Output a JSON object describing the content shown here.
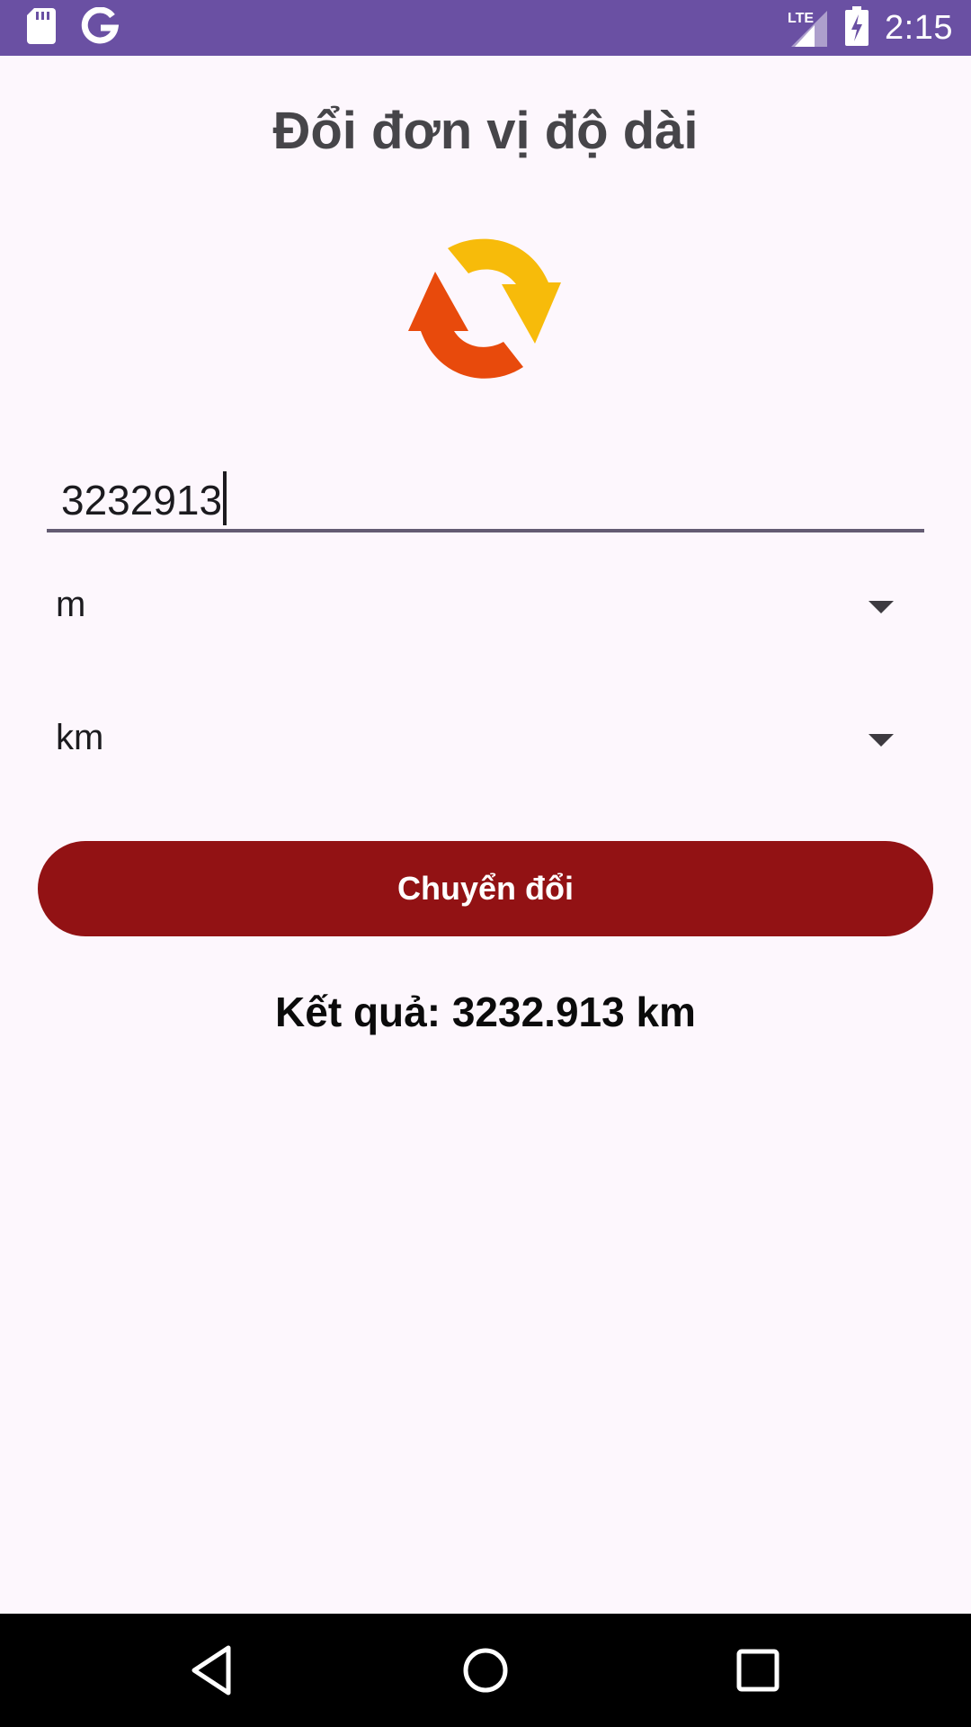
{
  "status_bar": {
    "time": "2:15",
    "network": "LTE",
    "icons": [
      "sd-card-icon",
      "google-icon",
      "lte-signal-icon",
      "battery-charging-icon"
    ]
  },
  "app": {
    "title": "Đổi đơn vị độ dài",
    "logo": "refresh-arrows-icon",
    "input_value": "3232913",
    "from_unit": "m",
    "to_unit": "km",
    "convert_label": "Chuyển đổi",
    "result_text": "Kết quả: 3232.913 km"
  },
  "nav_bar": {
    "icons": [
      "back-icon",
      "home-icon",
      "recents-icon"
    ]
  },
  "colors": {
    "status_bar": "#6a50a3",
    "background": "#fdf7fd",
    "button": "#921214",
    "logo_orange": "#e84a0c",
    "logo_yellow": "#f7bb0a"
  }
}
